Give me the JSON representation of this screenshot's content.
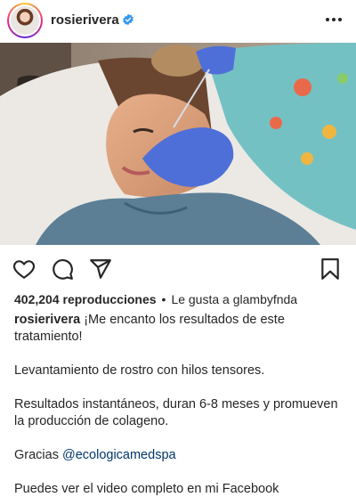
{
  "post": {
    "username": "rosierivera",
    "views": "402,204 reproducciones",
    "liked_by_prefix": "Le gusta a",
    "liked_by_user": "glambyfnda",
    "caption_intro": "¡Me encanto los resultados de este tratamiento!",
    "caption_line_2": "Levantamiento de rostro con hilos tensores.",
    "caption_line_3": "Resultados instantáneos, duran 6-8 meses y promueven la producción de colageno.",
    "caption_thanks": "Gracias",
    "caption_mention": "@ecologicamedspa",
    "caption_line_5": "Puedes ver el video completo en mi Facebook"
  },
  "icons": {
    "verified": "verified-badge-icon",
    "more": "more-options-icon",
    "like": "heart-icon",
    "comment": "comment-icon",
    "share": "send-icon",
    "save": "bookmark-icon"
  },
  "colors": {
    "text": "#262626",
    "verified": "#3897f0",
    "mention": "#00376b"
  }
}
